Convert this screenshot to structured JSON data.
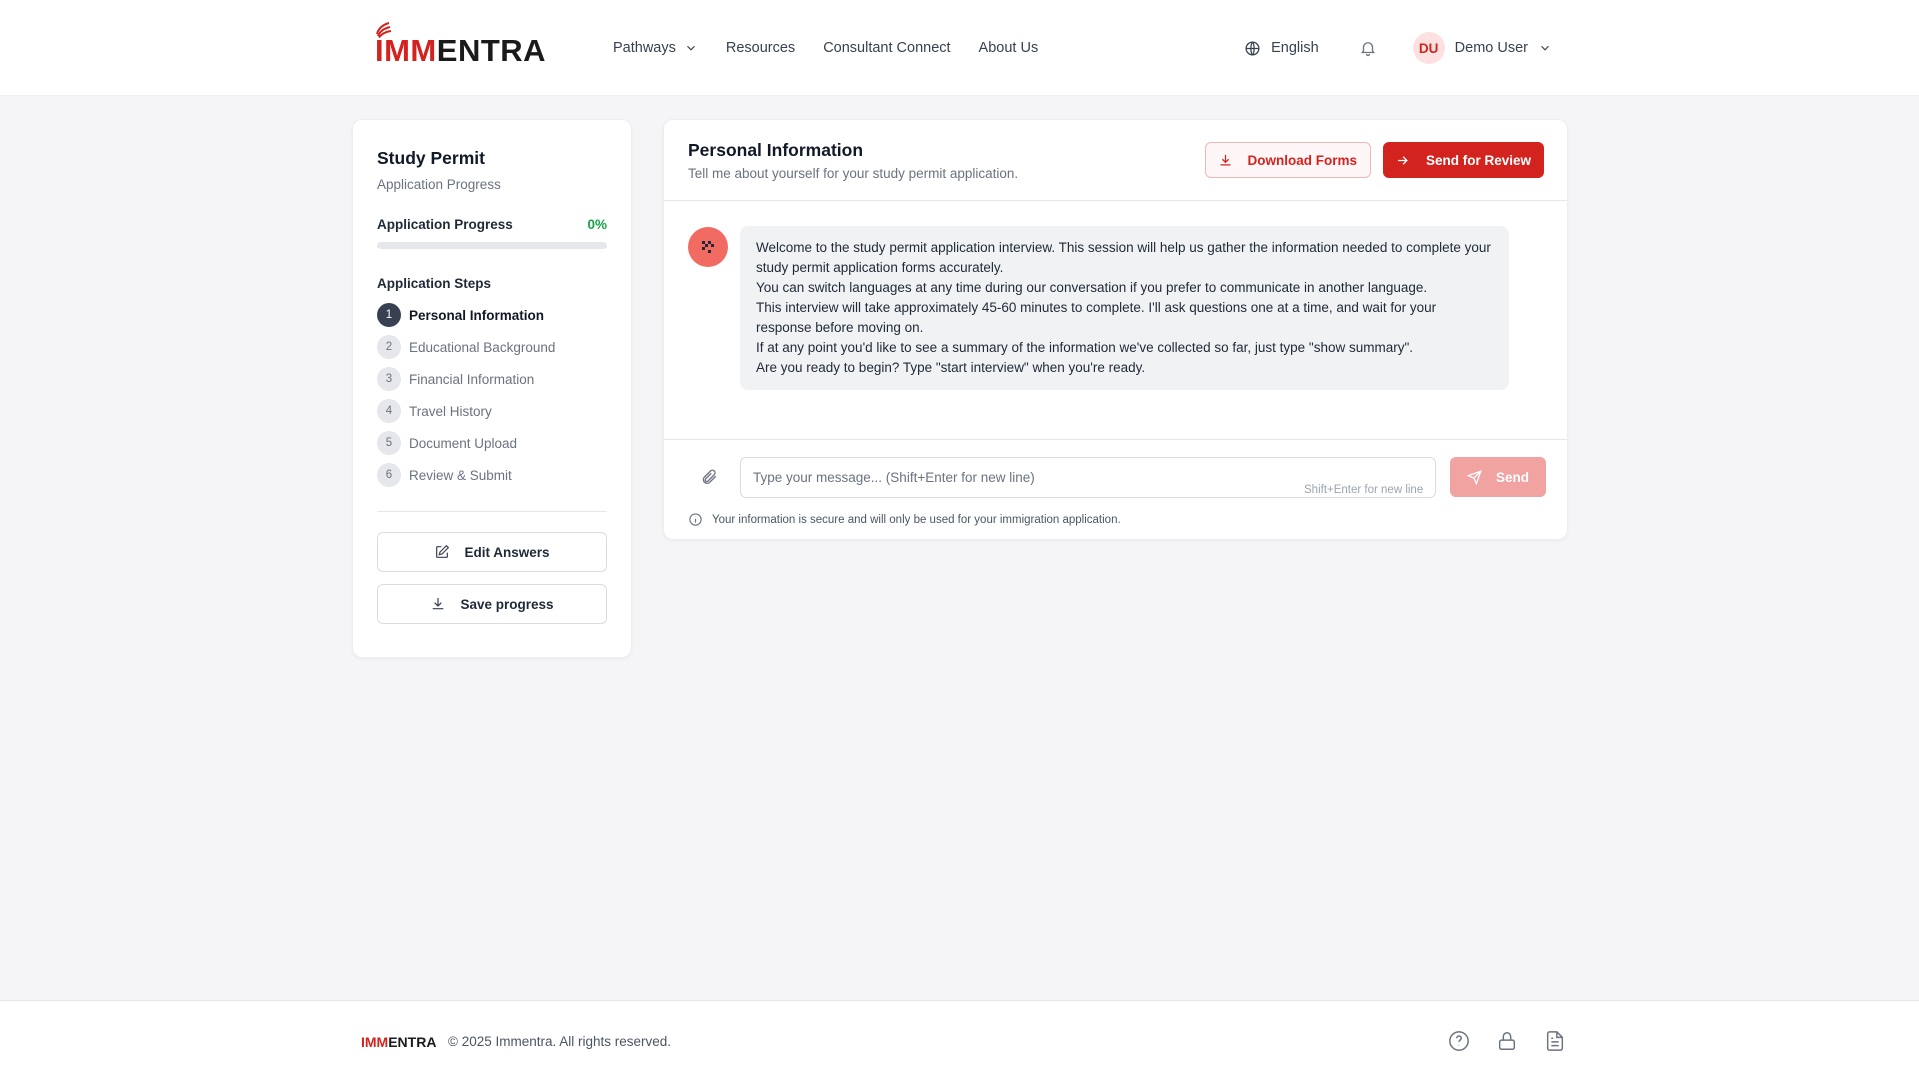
{
  "brand": {
    "name_red": "IMM",
    "name_dark": "ENTRA",
    "accent_color": "#d3231f"
  },
  "nav": {
    "items": [
      {
        "label": "Pathways",
        "has_dropdown": true
      },
      {
        "label": "Resources"
      },
      {
        "label": "Consultant Connect"
      },
      {
        "label": "About Us"
      }
    ]
  },
  "header": {
    "language": "English",
    "user_initials": "DU",
    "user_name": "Demo User"
  },
  "sidebar": {
    "title": "Study Permit",
    "subtitle": "Application Progress",
    "progress_label": "Application Progress",
    "progress_value": "0%",
    "progress_fraction": 0,
    "steps_title": "Application Steps",
    "steps": [
      {
        "num": "1",
        "label": "Personal Information",
        "active": true
      },
      {
        "num": "2",
        "label": "Educational Background"
      },
      {
        "num": "3",
        "label": "Financial Information"
      },
      {
        "num": "4",
        "label": "Travel History"
      },
      {
        "num": "5",
        "label": "Document Upload"
      },
      {
        "num": "6",
        "label": "Review & Submit"
      }
    ],
    "edit_label": "Edit Answers",
    "save_label": "Save progress"
  },
  "main": {
    "title": "Personal Information",
    "subtitle": "Tell me about yourself for your study permit application.",
    "download_label": "Download Forms",
    "review_label": "Send for Review",
    "message_lines": [
      "Welcome to the study permit application interview. This session will help us gather the information needed to complete your study permit application forms accurately.",
      "You can switch languages at any time during our conversation if you prefer to communicate in another language.",
      "This interview will take approximately 45-60 minutes to complete. I'll ask questions one at a time, and wait for your response before moving on.",
      "If at any point you'd like to see a summary of the information we've collected so far, just type \"show summary\".",
      "Are you ready to begin? Type \"start interview\" when you're ready."
    ],
    "input_placeholder": "Type your message... (Shift+Enter for new line)",
    "input_hint": "Shift+Enter for new line",
    "send_label": "Send",
    "secure_note": "Your information is secure and will only be used for your immigration application."
  },
  "footer": {
    "logo_red": "IMM",
    "logo_dark": "ENTRA",
    "copyright": "© 2025 Immentra. All rights reserved."
  }
}
